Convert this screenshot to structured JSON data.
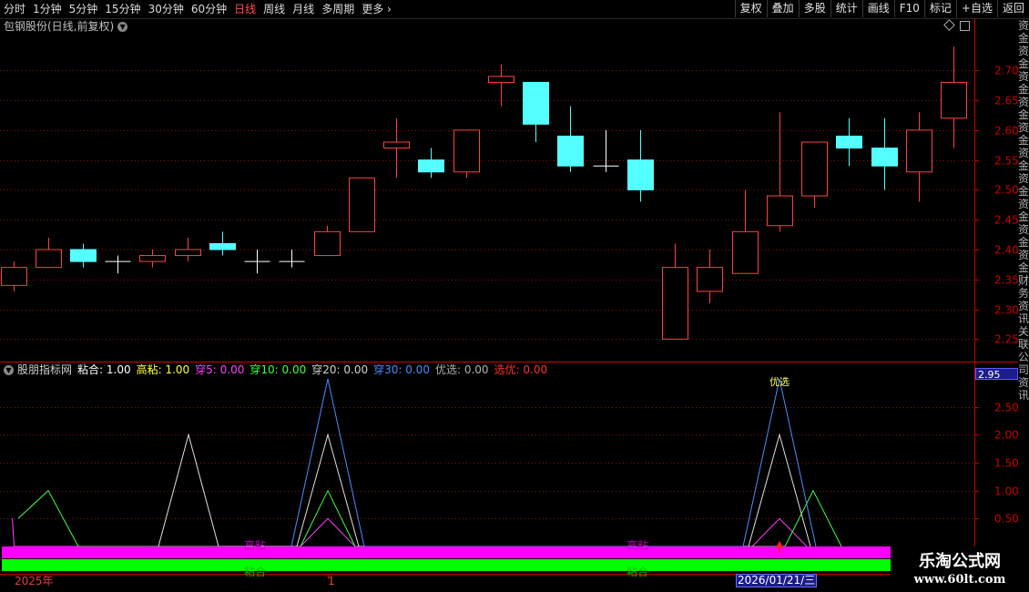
{
  "toolbar": {
    "left_items": [
      "分时",
      "1分钟",
      "5分钟",
      "15分钟",
      "30分钟",
      "60分钟",
      "日线",
      "周线",
      "月线",
      "多周期",
      "更多"
    ],
    "active_item": "日线",
    "right_items": [
      "复权",
      "叠加",
      "多股",
      "统计",
      "画线",
      "F10",
      "标记",
      "+自选",
      "返回"
    ]
  },
  "main_title": "包钢股份(日线,前复权)",
  "sub_legend": {
    "name": "股朋指标网",
    "items": [
      {
        "label": "粘合:",
        "value": "1.00",
        "color": "#ffffff"
      },
      {
        "label": "高粘:",
        "value": "1.00",
        "color": "#ffff40"
      },
      {
        "label": "穿5:",
        "value": "0.00",
        "color": "#ff40ff"
      },
      {
        "label": "穿10:",
        "value": "0.00",
        "color": "#40ff40"
      },
      {
        "label": "穿20:",
        "value": "0.00",
        "color": "#d0d0d0"
      },
      {
        "label": "穿30:",
        "value": "0.00",
        "color": "#4a8cff"
      },
      {
        "label": "优选:",
        "value": "0.00",
        "color": "#b0b0b0"
      },
      {
        "label": "选优:",
        "value": "0.00",
        "color": "#ff3030"
      }
    ]
  },
  "last_price_label": "2.95",
  "right_strip_text": "资金资金资金资金资金资金资金资金资金资金财务资讯关联公司资讯",
  "watermark": {
    "title": "乐淘公式网",
    "url": "www.60lt.com"
  },
  "dates": {
    "left": "2025年",
    "mid": "1",
    "right": "2026/01/21/三"
  },
  "bar_texts": {
    "magenta_label": "高粘",
    "green_label": "粘合",
    "top_label": "优选"
  },
  "colors": {
    "up": "#ff4040",
    "down": "#54ffff",
    "grid": "#8a1010",
    "axis": "#c80000"
  },
  "chart_data": {
    "type": "candlestick",
    "y_ticks": [
      2.25,
      2.3,
      2.35,
      2.4,
      2.45,
      2.5,
      2.55,
      2.6,
      2.65,
      2.7
    ],
    "ylim": [
      2.22,
      2.76
    ],
    "candles": [
      {
        "o": 2.34,
        "c": 2.37,
        "h": 2.38,
        "l": 2.33
      },
      {
        "o": 2.37,
        "c": 2.4,
        "h": 2.42,
        "l": 2.37
      },
      {
        "o": 2.4,
        "c": 2.38,
        "h": 2.41,
        "l": 2.37
      },
      {
        "o": 2.38,
        "c": 2.38,
        "h": 2.39,
        "l": 2.36
      },
      {
        "o": 2.38,
        "c": 2.39,
        "h": 2.4,
        "l": 2.37
      },
      {
        "o": 2.39,
        "c": 2.4,
        "h": 2.42,
        "l": 2.38
      },
      {
        "o": 2.41,
        "c": 2.4,
        "h": 2.43,
        "l": 2.39
      },
      {
        "o": 2.38,
        "c": 2.38,
        "h": 2.4,
        "l": 2.36
      },
      {
        "o": 2.38,
        "c": 2.38,
        "h": 2.4,
        "l": 2.37
      },
      {
        "o": 2.39,
        "c": 2.43,
        "h": 2.44,
        "l": 2.39
      },
      {
        "o": 2.43,
        "c": 2.52,
        "h": 2.52,
        "l": 2.43
      },
      {
        "o": 2.57,
        "c": 2.58,
        "h": 2.62,
        "l": 2.52
      },
      {
        "o": 2.55,
        "c": 2.53,
        "h": 2.57,
        "l": 2.52
      },
      {
        "o": 2.53,
        "c": 2.6,
        "h": 2.6,
        "l": 2.52
      },
      {
        "o": 2.68,
        "c": 2.69,
        "h": 2.71,
        "l": 2.64
      },
      {
        "o": 2.68,
        "c": 2.61,
        "h": 2.68,
        "l": 2.58
      },
      {
        "o": 2.59,
        "c": 2.54,
        "h": 2.64,
        "l": 2.53
      },
      {
        "o": 2.54,
        "c": 2.54,
        "h": 2.6,
        "l": 2.53
      },
      {
        "o": 2.55,
        "c": 2.5,
        "h": 2.6,
        "l": 2.48
      },
      {
        "o": 2.25,
        "c": 2.37,
        "h": 2.41,
        "l": 2.25
      },
      {
        "o": 2.33,
        "c": 2.37,
        "h": 2.4,
        "l": 2.31
      },
      {
        "o": 2.36,
        "c": 2.43,
        "h": 2.5,
        "l": 2.36
      },
      {
        "o": 2.44,
        "c": 2.49,
        "h": 2.63,
        "l": 2.43
      },
      {
        "o": 2.49,
        "c": 2.58,
        "h": 2.58,
        "l": 2.47
      },
      {
        "o": 2.59,
        "c": 2.57,
        "h": 2.62,
        "l": 2.54
      },
      {
        "o": 2.57,
        "c": 2.54,
        "h": 2.62,
        "l": 2.5
      },
      {
        "o": 2.53,
        "c": 2.6,
        "h": 2.63,
        "l": 2.48
      },
      {
        "o": 2.62,
        "c": 2.68,
        "h": 2.74,
        "l": 2.57
      }
    ],
    "sub_y_ticks": [
      0.5,
      1.0,
      1.5,
      2.0,
      2.5
    ],
    "sub_ylim": [
      0,
      3.0
    ],
    "sub_series": [
      {
        "name": "穿5",
        "color": "#ff40ff",
        "points": [
          [
            13.5,
            0.5
          ],
          [
            15.5,
            0
          ],
          [
            330,
            0
          ],
          [
            360,
            0.5
          ],
          [
            390,
            0
          ],
          [
            826,
            0
          ],
          [
            856,
            0.5
          ],
          [
            886,
            0
          ]
        ]
      },
      {
        "name": "穿10",
        "color": "#40ff40",
        "points": [
          [
            20,
            0.5
          ],
          [
            53,
            1.0
          ],
          [
            86,
            0
          ],
          [
            330,
            0
          ],
          [
            360,
            1.0
          ],
          [
            390,
            0
          ],
          [
            862,
            0
          ],
          [
            893,
            1.0
          ],
          [
            924,
            0
          ]
        ]
      },
      {
        "name": "穿20",
        "color": "#e0e0e0",
        "points": [
          [
            174,
            0
          ],
          [
            207,
            2.0
          ],
          [
            240,
            0
          ],
          [
            326,
            0
          ],
          [
            360,
            2.0
          ],
          [
            394,
            0
          ],
          [
            822,
            0
          ],
          [
            856,
            2.0
          ],
          [
            890,
            0
          ]
        ]
      },
      {
        "name": "穿30",
        "color": "#4a8cff",
        "points": [
          [
            320,
            0
          ],
          [
            360,
            3.0
          ],
          [
            400,
            0
          ],
          [
            816,
            0
          ],
          [
            856,
            3.0
          ],
          [
            896,
            0
          ]
        ]
      }
    ],
    "signal_bars": [
      {
        "name": "高粘",
        "color": "#ff00ff",
        "y_top": 600,
        "y_bot": 613
      },
      {
        "name": "粘合",
        "color": "#00ff00",
        "y_top": 614,
        "y_bot": 627
      }
    ]
  }
}
